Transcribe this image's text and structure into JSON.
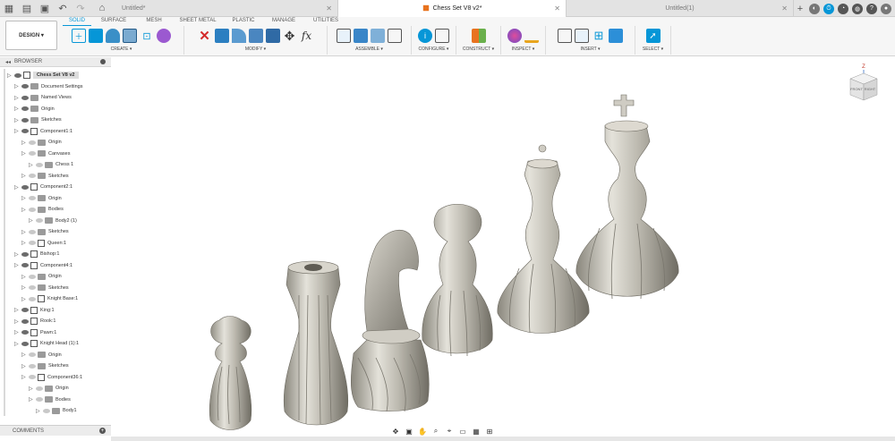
{
  "tabs": {
    "untitled1": "Untitled*",
    "active": "Chess Set V8 v2*",
    "untitled2": "Untitled(1)"
  },
  "toolbar": {
    "design_label": "DESIGN ▾",
    "workspace_tabs": [
      "SOLID",
      "SURFACE",
      "MESH",
      "SHEET METAL",
      "PLASTIC",
      "MANAGE",
      "UTILITIES"
    ],
    "groups": [
      "CREATE ▾",
      "MODIFY ▾",
      "ASSEMBLE ▾",
      "CONFIGURE ▾",
      "CONSTRUCT ▾",
      "INSPECT ▾",
      "INSERT ▾",
      "SELECT ▾"
    ]
  },
  "browser": {
    "title": "BROWSER",
    "items": [
      {
        "label": "Chess Set V8 v2",
        "level": 0
      },
      {
        "label": "Document Settings",
        "level": 1
      },
      {
        "label": "Named Views",
        "level": 1
      },
      {
        "label": "Origin",
        "level": 1
      },
      {
        "label": "Sketches",
        "level": 1
      },
      {
        "label": "Component1:1",
        "level": 1
      },
      {
        "label": "Origin",
        "level": 2
      },
      {
        "label": "Canvases",
        "level": 2
      },
      {
        "label": "Chess 1",
        "level": 3
      },
      {
        "label": "Sketches",
        "level": 2
      },
      {
        "label": "Component2:1",
        "level": 1
      },
      {
        "label": "Origin",
        "level": 2
      },
      {
        "label": "Bodies",
        "level": 2
      },
      {
        "label": "Body2 (1)",
        "level": 3
      },
      {
        "label": "Sketches",
        "level": 2
      },
      {
        "label": "Queen:1",
        "level": 2
      },
      {
        "label": "Bishop:1",
        "level": 1
      },
      {
        "label": "Component4:1",
        "level": 1
      },
      {
        "label": "Origin",
        "level": 2
      },
      {
        "label": "Sketches",
        "level": 2
      },
      {
        "label": "Knight Base:1",
        "level": 2
      },
      {
        "label": "King:1",
        "level": 1
      },
      {
        "label": "Rook:1",
        "level": 1
      },
      {
        "label": "Pawn:1",
        "level": 1
      },
      {
        "label": "Knight Head (1):1",
        "level": 1
      },
      {
        "label": "Origin",
        "level": 2
      },
      {
        "label": "Sketches",
        "level": 2
      },
      {
        "label": "Component36:1",
        "level": 2
      },
      {
        "label": "Origin",
        "level": 3
      },
      {
        "label": "Bodies",
        "level": 3
      },
      {
        "label": "Body1",
        "level": 4
      }
    ]
  },
  "comments": {
    "label": "COMMENTS"
  },
  "viewcube": {
    "front": "FRONT",
    "right": "RIGHT",
    "axis": "Z"
  }
}
